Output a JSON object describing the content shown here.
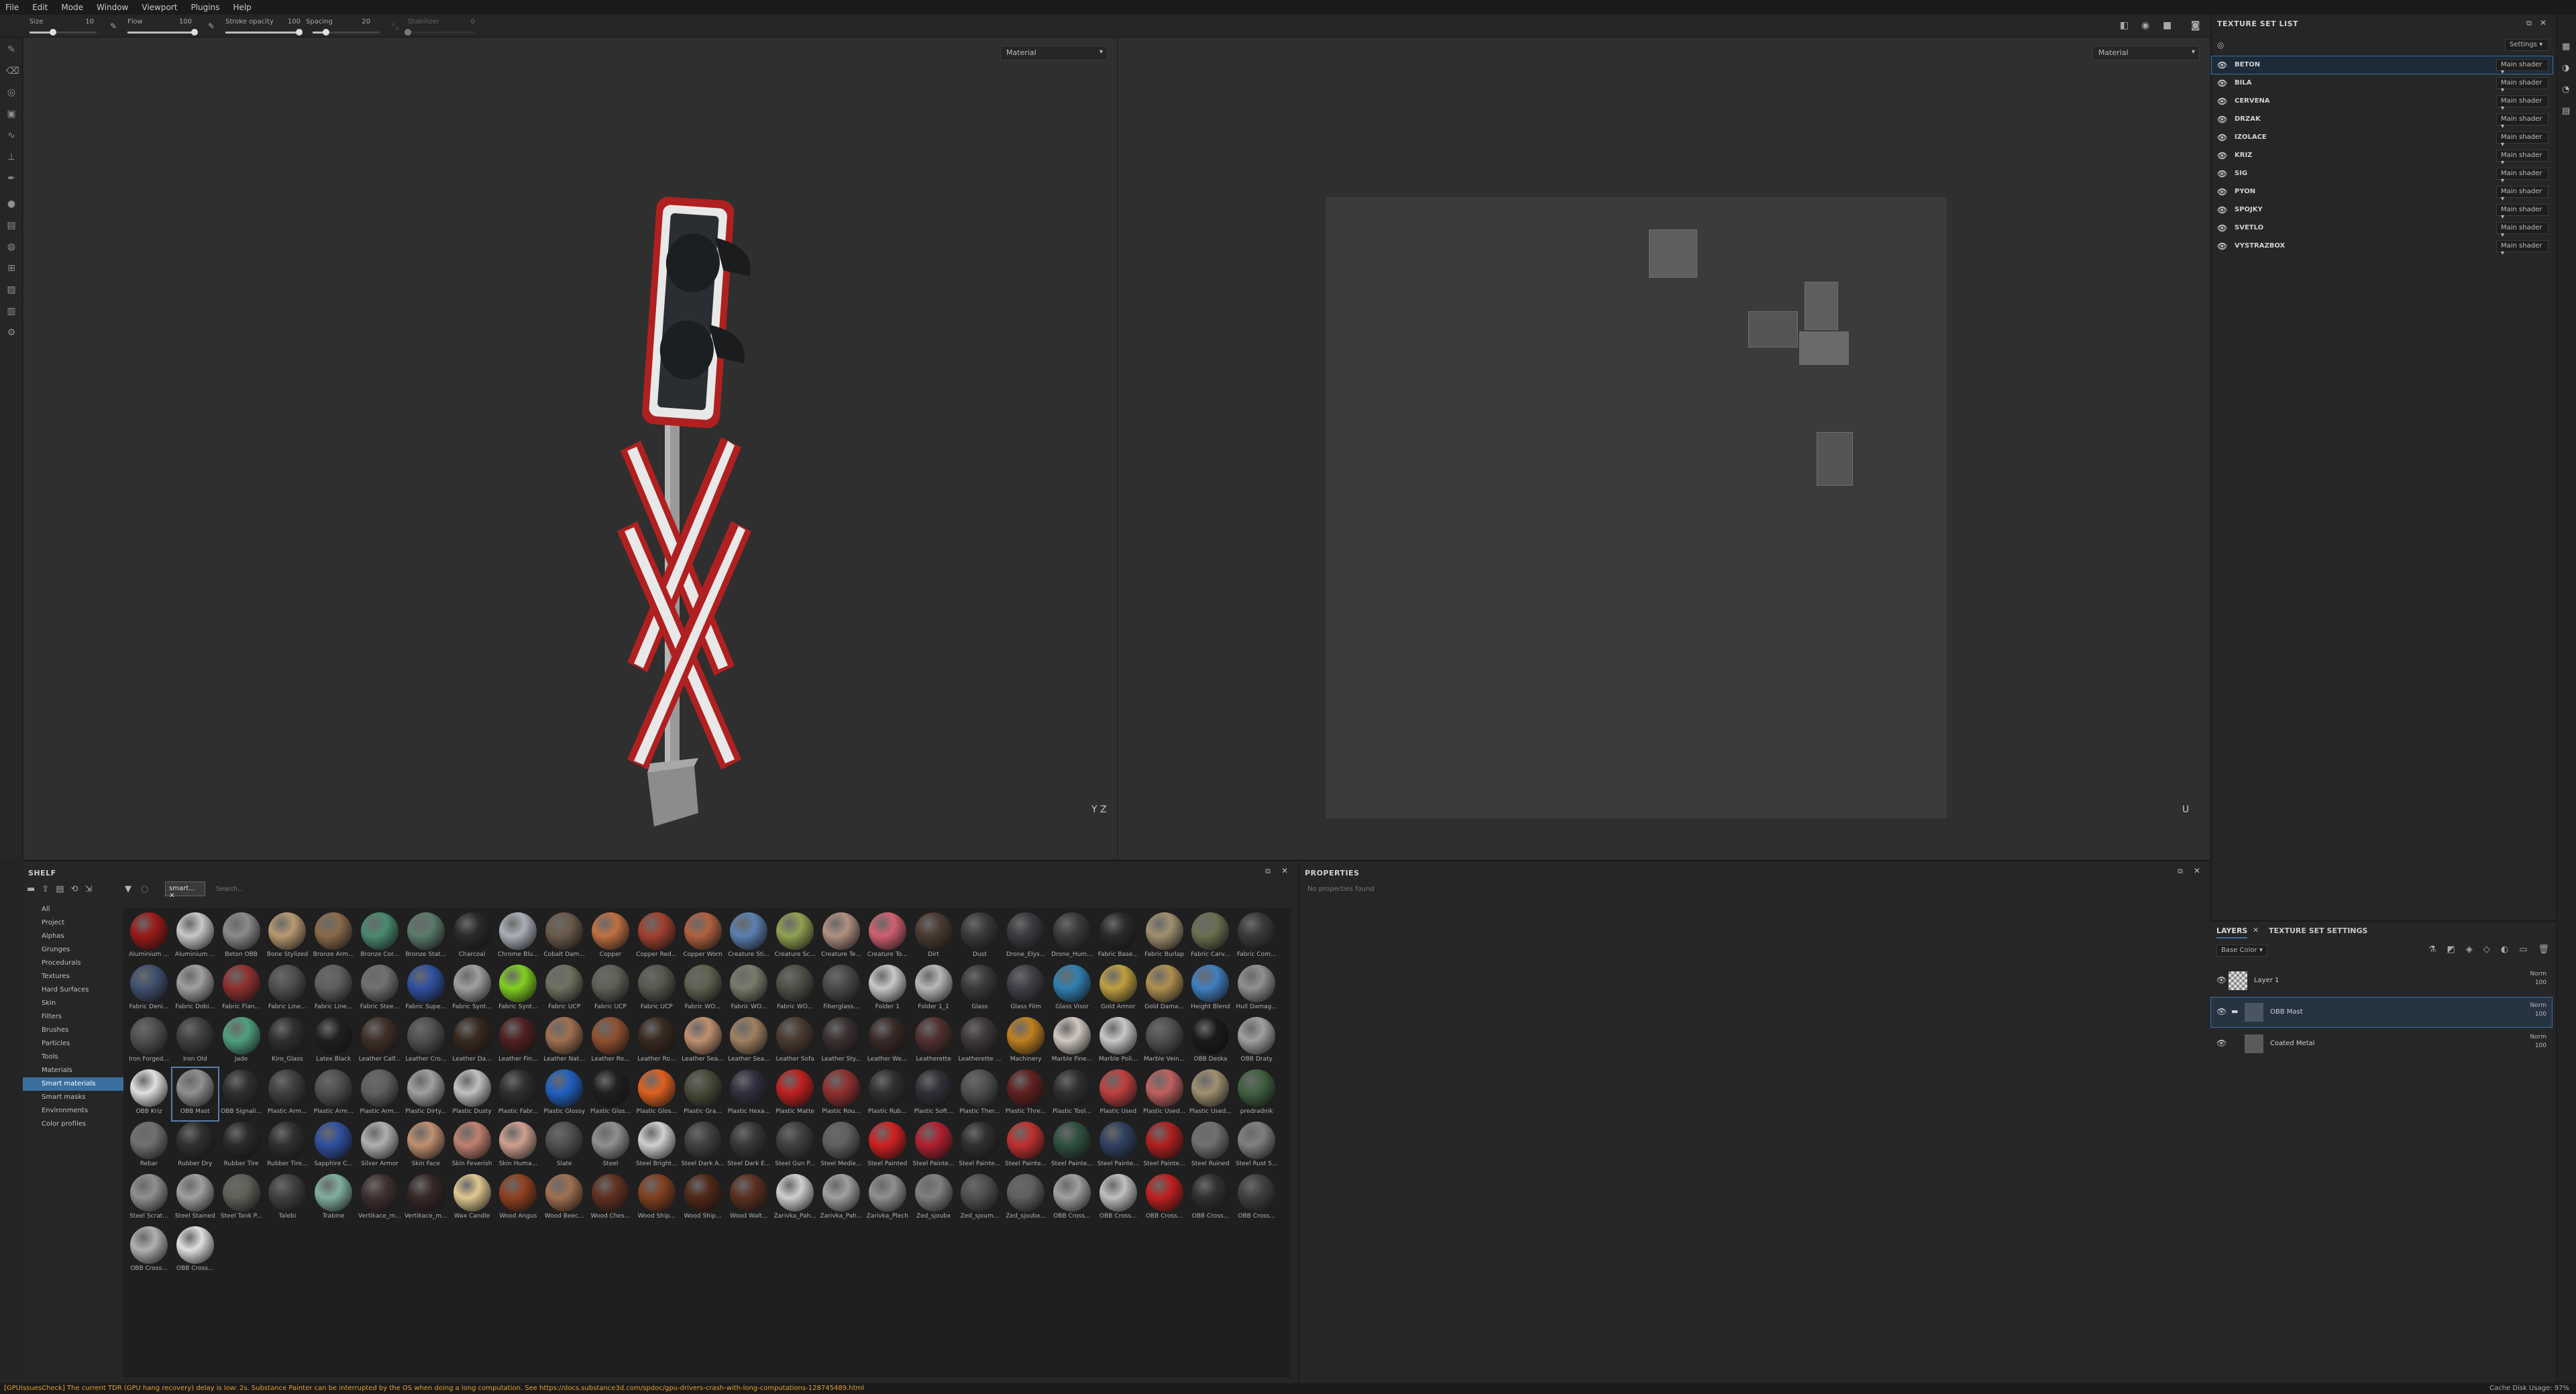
{
  "menu": [
    "File",
    "Edit",
    "Mode",
    "Window",
    "Viewport",
    "Plugins",
    "Help"
  ],
  "tool_options": {
    "size": {
      "label": "Size",
      "value": "10",
      "fraction": 0.35
    },
    "flow": {
      "label": "Flow",
      "value": "100",
      "fraction": 1.0
    },
    "stroke_opacity": {
      "label": "Stroke opacity",
      "value": "100",
      "fraction": 1.0
    },
    "spacing": {
      "label": "Spacing",
      "value": "20",
      "fraction": 0.2
    },
    "stabilizer": {
      "label": "Stabilizer",
      "value": "0",
      "fraction": 0.0
    }
  },
  "viewport_left": {
    "mode": "Material",
    "axis_label": "Y Z"
  },
  "viewport_right": {
    "mode": "Material",
    "axis_label": "U"
  },
  "texture_set_list": {
    "title": "TEXTURE SET LIST",
    "settings_label": "Settings",
    "items": [
      {
        "name": "BETON",
        "shader": "Main shader",
        "selected": true
      },
      {
        "name": "BILA",
        "shader": "Main shader"
      },
      {
        "name": "CERVENA",
        "shader": "Main shader"
      },
      {
        "name": "DRZAK",
        "shader": "Main shader"
      },
      {
        "name": "IZOLACE",
        "shader": "Main shader"
      },
      {
        "name": "KRIZ",
        "shader": "Main shader"
      },
      {
        "name": "SIG",
        "shader": "Main shader"
      },
      {
        "name": "PYON",
        "shader": "Main shader"
      },
      {
        "name": "SPOJKY",
        "shader": "Main shader"
      },
      {
        "name": "SVETLO",
        "shader": "Main shader"
      },
      {
        "name": "VYSTRAZBOX",
        "shader": "Main shader"
      }
    ]
  },
  "layers_panel": {
    "tabs": [
      "LAYERS",
      "TEXTURE SET SETTINGS"
    ],
    "channel": "Base Color",
    "layers": [
      {
        "name": "Layer 1",
        "blend": "Norm",
        "opacity": "100",
        "type": "fill"
      },
      {
        "name": "OBB Mast",
        "blend": "Norm",
        "opacity": "100",
        "type": "folder",
        "selected": true
      },
      {
        "name": "Coated Metal",
        "blend": "Norm",
        "opacity": "100",
        "type": "sub"
      }
    ]
  },
  "shelf": {
    "title": "SHELF",
    "filter_tag": "smart...",
    "search_placeholder": "Search...",
    "categories": [
      "All",
      "Project",
      "Alphas",
      "Grunges",
      "Procedurals",
      "Textures",
      "Hard Surfaces",
      "Skin",
      "Filters",
      "Brushes",
      "Particles",
      "Tools",
      "Materials",
      "Smart materials",
      "Smart masks",
      "Environments",
      "Color profiles"
    ],
    "selected_category": "Smart materials",
    "materials": [
      {
        "n": "Aluminium ...",
        "c": "#9a1a18"
      },
      {
        "n": "Aluminium ...",
        "c": "#c8c8c8"
      },
      {
        "n": "Beton OBB",
        "c": "#8a8a8a"
      },
      {
        "n": "Bone Stylized",
        "c": "#b89a70"
      },
      {
        "n": "Bronze Arm...",
        "c": "#8a6a4a"
      },
      {
        "n": "Bronze Cor...",
        "c": "#4a8a70"
      },
      {
        "n": "Bronze Stat...",
        "c": "#5a7a6a"
      },
      {
        "n": "Charcoal",
        "c": "#2a2a2a"
      },
      {
        "n": "Chrome Blu...",
        "c": "#aab0b8"
      },
      {
        "n": "Cobalt Dam...",
        "c": "#6a5a4a"
      },
      {
        "n": "Copper",
        "c": "#c07040"
      },
      {
        "n": "Copper Red...",
        "c": "#a04030"
      },
      {
        "n": "Copper Worn",
        "c": "#b06040"
      },
      {
        "n": "Creature Sti...",
        "c": "#5a80b0"
      },
      {
        "n": "Creature Sc...",
        "c": "#90a050"
      },
      {
        "n": "Creature Te...",
        "c": "#b09080"
      },
      {
        "n": "Creature To...",
        "c": "#d06070"
      },
      {
        "n": "Dirt",
        "c": "#4a3a30"
      },
      {
        "n": "Dust",
        "c": "#3a3a3a"
      },
      {
        "n": "Drone_Elys...",
        "c": "#3a3a40"
      },
      {
        "n": "Drone_Hum...",
        "c": "#3a3a3a"
      },
      {
        "n": "Fabric Base...",
        "c": "#2a2a2a"
      },
      {
        "n": "Fabric Burlap",
        "c": "#a09070"
      },
      {
        "n": "Fabric Carv...",
        "c": "#6a7050"
      },
      {
        "n": "Fabric Com...",
        "c": "#3a3a3a"
      },
      {
        "n": "Fabric Deni...",
        "c": "#405070"
      },
      {
        "n": "Fabric Dobi...",
        "c": "#a0a0a0"
      },
      {
        "n": "Fabric Flan...",
        "c": "#903030"
      },
      {
        "n": "Fabric Line...",
        "c": "#505050"
      },
      {
        "n": "Fabric Line...",
        "c": "#606060"
      },
      {
        "n": "Fabric Stee...",
        "c": "#707070"
      },
      {
        "n": "Fabric Supe...",
        "c": "#3050a0"
      },
      {
        "n": "Fabric Synt...",
        "c": "#a0a0a0"
      },
      {
        "n": "Fabric Synt...",
        "c": "#80d020"
      },
      {
        "n": "Fabric UCP",
        "c": "#707060"
      },
      {
        "n": "Fabric UCP",
        "c": "#606058"
      },
      {
        "n": "Fabric UCP",
        "c": "#585850"
      },
      {
        "n": "Fabric WO...",
        "c": "#606050"
      },
      {
        "n": "Fabric WO...",
        "c": "#7a7a6a"
      },
      {
        "n": "Fabric WO...",
        "c": "#505048"
      },
      {
        "n": "Fiberglass...",
        "c": "#4a4a4a"
      },
      {
        "n": "Folder 1",
        "c": "#c8c8c8"
      },
      {
        "n": "Folder 1_1",
        "c": "#b8b8b8"
      },
      {
        "n": "Glass",
        "c": "#3a3a3a"
      },
      {
        "n": "Glass Film",
        "c": "#404048"
      },
      {
        "n": "Glass Visor",
        "c": "#3080b0"
      },
      {
        "n": "Gold Armor",
        "c": "#c0a040"
      },
      {
        "n": "Gold Dama...",
        "c": "#b09050"
      },
      {
        "n": "Height Blend",
        "c": "#4080c0"
      },
      {
        "n": "Hull Damag...",
        "c": "#909090"
      },
      {
        "n": "Iron Forged...",
        "c": "#505050"
      },
      {
        "n": "Iron Old",
        "c": "#404040"
      },
      {
        "n": "Jade",
        "c": "#50a080"
      },
      {
        "n": "Kiro_Glass",
        "c": "#303030"
      },
      {
        "n": "Latex Black",
        "c": "#202020"
      },
      {
        "n": "Leather Calf...",
        "c": "#403028"
      },
      {
        "n": "Leather Cro...",
        "c": "#505050"
      },
      {
        "n": "Leather Da...",
        "c": "#3a2a20"
      },
      {
        "n": "Leather Fin...",
        "c": "#502020"
      },
      {
        "n": "Leather Nat...",
        "c": "#a07050"
      },
      {
        "n": "Leather Ro...",
        "c": "#905030"
      },
      {
        "n": "Leather Ro...",
        "c": "#3a2a20"
      },
      {
        "n": "Leather Sea...",
        "c": "#c09070"
      },
      {
        "n": "Leather Sea...",
        "c": "#a08060"
      },
      {
        "n": "Leather Sofa",
        "c": "#4a3a30"
      },
      {
        "n": "Leather Sty...",
        "c": "#3a3030"
      },
      {
        "n": "Leather We...",
        "c": "#3a2a28"
      },
      {
        "n": "Leatherette",
        "c": "#503030"
      },
      {
        "n": "Leatherette ...",
        "c": "#403838"
      },
      {
        "n": "Machinery",
        "c": "#c08020"
      },
      {
        "n": "Marble Fine...",
        "c": "#d0c8c0"
      },
      {
        "n": "Marble Poli...",
        "c": "#c8c8c8"
      },
      {
        "n": "Marble Vein...",
        "c": "#505050"
      },
      {
        "n": "OBB Deska",
        "c": "#1a1a1a"
      },
      {
        "n": "OBB Draty",
        "c": "#a0a0a0"
      },
      {
        "n": "OBB Kriz",
        "c": "#e0e0e0"
      },
      {
        "n": "OBB Mast",
        "c": "#909090"
      },
      {
        "n": "OBB Signali...",
        "c": "#303030"
      },
      {
        "n": "Plastic Arm...",
        "c": "#404040"
      },
      {
        "n": "Plastic Arm...",
        "c": "#505050"
      },
      {
        "n": "Plastic Arm...",
        "c": "#606060"
      },
      {
        "n": "Plastic Dirty...",
        "c": "#a0a0a0"
      },
      {
        "n": "Plastic Dusty",
        "c": "#c0c0c0"
      },
      {
        "n": "Plastic Fabr...",
        "c": "#303030"
      },
      {
        "n": "Plastic Glossy",
        "c": "#2060c0"
      },
      {
        "n": "Plastic Glos...",
        "c": "#202020"
      },
      {
        "n": "Plastic Glos...",
        "c": "#e06020"
      },
      {
        "n": "Plastic Gra...",
        "c": "#4a4a3a"
      },
      {
        "n": "Plastic Hexa...",
        "c": "#303040"
      },
      {
        "n": "Plastic Matte",
        "c": "#c02020"
      },
      {
        "n": "Plastic Rou...",
        "c": "#903030"
      },
      {
        "n": "Plastic Rub...",
        "c": "#303030"
      },
      {
        "n": "Plastic Soft...",
        "c": "#303038"
      },
      {
        "n": "Plastic Ther...",
        "c": "#505050"
      },
      {
        "n": "Plastic Thre...",
        "c": "#602020"
      },
      {
        "n": "Plastic Tool...",
        "c": "#303030"
      },
      {
        "n": "Plastic Used",
        "c": "#c04040"
      },
      {
        "n": "Plastic Used...",
        "c": "#c06060"
      },
      {
        "n": "Plastic Used...",
        "c": "#a09070"
      },
      {
        "n": "predradnik",
        "c": "#406040"
      },
      {
        "n": "Rebar",
        "c": "#707070"
      },
      {
        "n": "Rubber Dry",
        "c": "#303030"
      },
      {
        "n": "Rubber Tire",
        "c": "#2a2a2a"
      },
      {
        "n": "Rubber Tire...",
        "c": "#303030"
      },
      {
        "n": "Sapphire C...",
        "c": "#3050a0"
      },
      {
        "n": "Silver Armor",
        "c": "#b0b0b0"
      },
      {
        "n": "Skin Face",
        "c": "#c09070"
      },
      {
        "n": "Skin Feverish",
        "c": "#c08070"
      },
      {
        "n": "Skin Huma...",
        "c": "#d0a090"
      },
      {
        "n": "Slate",
        "c": "#505050"
      },
      {
        "n": "Steel",
        "c": "#909090"
      },
      {
        "n": "Steel Bright...",
        "c": "#d0d0d0"
      },
      {
        "n": "Steel Dark A...",
        "c": "#404040"
      },
      {
        "n": "Steel Dark E...",
        "c": "#383838"
      },
      {
        "n": "Steel Gun P...",
        "c": "#404040"
      },
      {
        "n": "Steel Medie...",
        "c": "#606060"
      },
      {
        "n": "Steel Painted",
        "c": "#d02020"
      },
      {
        "n": "Steel Painte...",
        "c": "#b02030"
      },
      {
        "n": "Steel Painte...",
        "c": "#303030"
      },
      {
        "n": "Steel Painte...",
        "c": "#c03030"
      },
      {
        "n": "Steel Painte...",
        "c": "#305040"
      },
      {
        "n": "Steel Painte...",
        "c": "#304060"
      },
      {
        "n": "Steel Painte...",
        "c": "#b02020"
      },
      {
        "n": "Steel Ruined",
        "c": "#707070"
      },
      {
        "n": "Steel Rust S...",
        "c": "#808080"
      },
      {
        "n": "Steel Scrat...",
        "c": "#909090"
      },
      {
        "n": "Steel Stained",
        "c": "#a0a0a0"
      },
      {
        "n": "Steel Tank P...",
        "c": "#606058"
      },
      {
        "n": "Talebi",
        "c": "#404040"
      },
      {
        "n": "Trabine",
        "c": "#80b0a0"
      },
      {
        "n": "Vertikace_m...",
        "c": "#403030"
      },
      {
        "n": "Vertikace_m...",
        "c": "#382828"
      },
      {
        "n": "Wax Candle",
        "c": "#e0c890"
      },
      {
        "n": "Wood Angus",
        "c": "#904020"
      },
      {
        "n": "Wood Beec...",
        "c": "#a07050"
      },
      {
        "n": "Wood Ches...",
        "c": "#603020"
      },
      {
        "n": "Wood Ship...",
        "c": "#804020"
      },
      {
        "n": "Wood Ship...",
        "c": "#502818"
      },
      {
        "n": "Wood Walt...",
        "c": "#5a3020"
      },
      {
        "n": "Zarivka_Pah...",
        "c": "#d0d0d0"
      },
      {
        "n": "Zarivka_Pah...",
        "c": "#a0a0a0"
      },
      {
        "n": "Zarivka_Plech",
        "c": "#909090"
      },
      {
        "n": "Zed_sjoubx",
        "c": "#808080"
      },
      {
        "n": "Zed_sjoum...",
        "c": "#505050"
      },
      {
        "n": "Zed_sjoubx...",
        "c": "#606060"
      },
      {
        "n": "OBB Cross...",
        "c": "#a0a0a0"
      },
      {
        "n": "OBB Cross...",
        "c": "#c0c0c0"
      },
      {
        "n": "OBB Cross...",
        "c": "#c02020"
      },
      {
        "n": "OBB Cross...",
        "c": "#303030"
      },
      {
        "n": "OBB Cross...",
        "c": "#404040"
      },
      {
        "n": "OBB Cross...",
        "c": "#b0b0b0"
      },
      {
        "n": "OBB Cross...",
        "c": "#e0e0e0"
      }
    ],
    "selected_material": "OBB Mast"
  },
  "properties": {
    "title": "PROPERTIES",
    "empty_text": "No properties found"
  },
  "status": {
    "message": "[GPUIssuesCheck] The current TDR (GPU hang recovery) delay is low: 2s. Substance Painter can be interrupted by the OS when doing a long computation. See https://docs.substance3d.com/spdoc/gpu-drivers-crash-with-long-computations-128745489.html",
    "cache": "Cache Disk Usage:    97%"
  },
  "colors": {
    "accent": "#3b6fa0",
    "warning": "#e0a030",
    "selection": "#5a7fa8"
  }
}
